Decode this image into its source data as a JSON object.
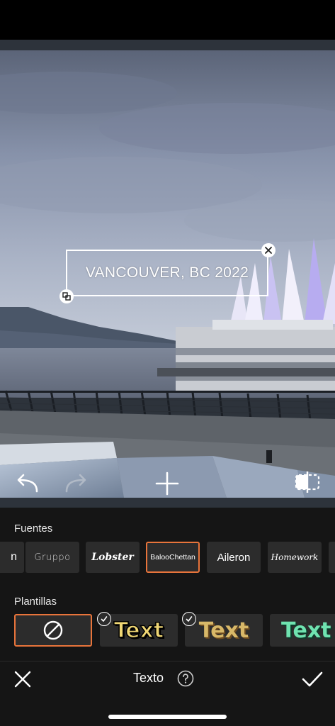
{
  "photo": {
    "overlay_text": "VANCOUVER, BC 2022"
  },
  "toolbar": {
    "undo_icon": "undo-icon",
    "redo_icon": "redo-icon",
    "add_icon": "plus-icon",
    "compare_icon": "compare-icon"
  },
  "fonts": {
    "label": "Fuentes",
    "items": [
      {
        "label": "n"
      },
      {
        "label": "Gruppo"
      },
      {
        "label": "Lobster"
      },
      {
        "label": "BalooChettan",
        "selected": true
      },
      {
        "label": "Aileron"
      },
      {
        "label": "Homework"
      }
    ]
  },
  "templates": {
    "label": "Plantillas",
    "items": [
      {
        "type": "none",
        "icon": "no-template-icon",
        "selected": true
      },
      {
        "label": "Text",
        "color": "#f0d774",
        "outline": "#000000",
        "premium_check": true
      },
      {
        "label": "Text",
        "color": "#d8b868",
        "outline": "#6b4a20",
        "premium_check": true
      },
      {
        "label": "Text",
        "color": "#6fe3b0",
        "outline": "#0d3b2a",
        "premium_check": false
      }
    ]
  },
  "bottom_bar": {
    "title": "Texto",
    "cancel_icon": "close-icon",
    "help_icon": "help-icon",
    "confirm_icon": "checkmark-icon"
  },
  "colors": {
    "accent": "#e8743b",
    "panel_bg": "#151515",
    "chip_bg": "#2c2c2c"
  }
}
